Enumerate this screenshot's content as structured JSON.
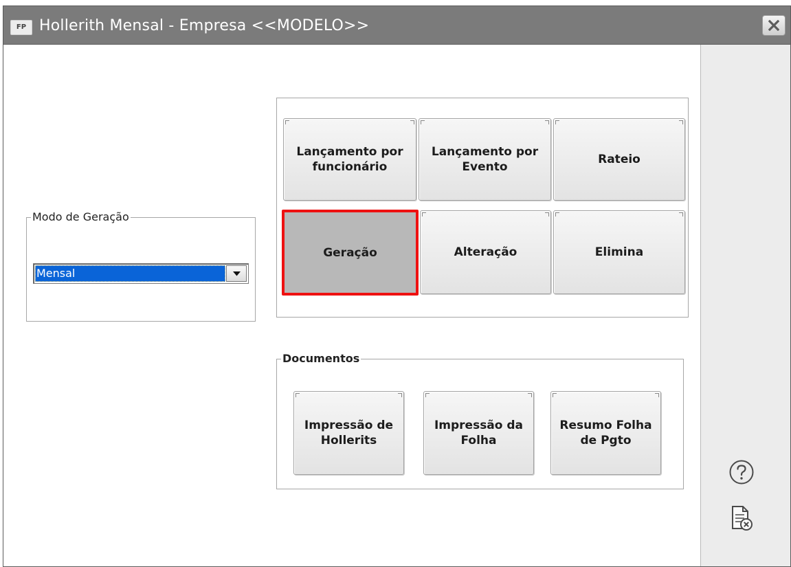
{
  "window": {
    "app_badge": "FP",
    "title": "Hollerith Mensal - Empresa <<MODELO>>"
  },
  "modo_geracao": {
    "legend": "Modo de Geração",
    "selected": "Mensal"
  },
  "actions": {
    "lancamento_funcionario": "Lançamento por\nfuncionário",
    "lancamento_evento": "Lançamento por\nEvento",
    "rateio": "Rateio",
    "geracao": "Geração",
    "alteracao": "Alteração",
    "elimina": "Elimina"
  },
  "documentos": {
    "legend": "Documentos",
    "impressao_hollerits": "Impressão de\nHollerits",
    "impressao_folha": "Impressão da\nFolha",
    "resumo_folha": "Resumo Folha\nde Pgto"
  },
  "icons": {
    "help": "help-icon",
    "close_document": "document-close-icon",
    "window_close": "close-icon"
  },
  "colors": {
    "titlebar": "#7b7b7b",
    "selection": "#0a64d8",
    "highlight_border": "#ee1111"
  }
}
